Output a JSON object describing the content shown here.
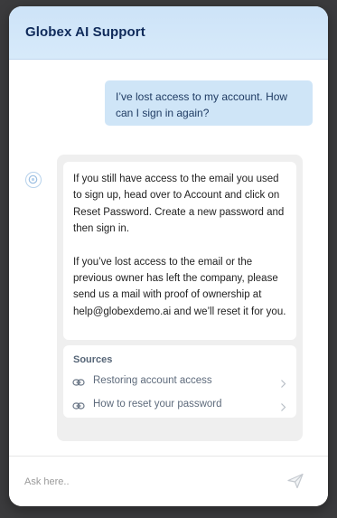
{
  "header": {
    "title": "Globex AI Support"
  },
  "conversation": {
    "user_message": "I’ve lost access to my account. How can I sign in again?",
    "bot_reply": {
      "paragraph_1": "If you still have access to the email you used to sign up, head over to Account and click on Reset Password. Create a new password and then sign in.",
      "paragraph_2": "If you’ve lost access to the email or the previous owner has left the company, please send us a mail with proof of ownership at help@globexdemo.ai and we’ll reset it for you."
    },
    "sources": {
      "title": "Sources",
      "items": [
        {
          "label": "Restoring account access",
          "icon": "link-icon"
        },
        {
          "label": "How to reset your password",
          "icon": "link-icon"
        }
      ]
    }
  },
  "composer": {
    "placeholder": "Ask here..",
    "send_icon": "send-icon"
  },
  "colors": {
    "header_bg": "#cde3f8",
    "header_title": "#0f2a5a",
    "user_bubble_bg": "#cfe5f7",
    "bot_card_bg": "#efefef",
    "backdrop": "#3b3b3d"
  }
}
